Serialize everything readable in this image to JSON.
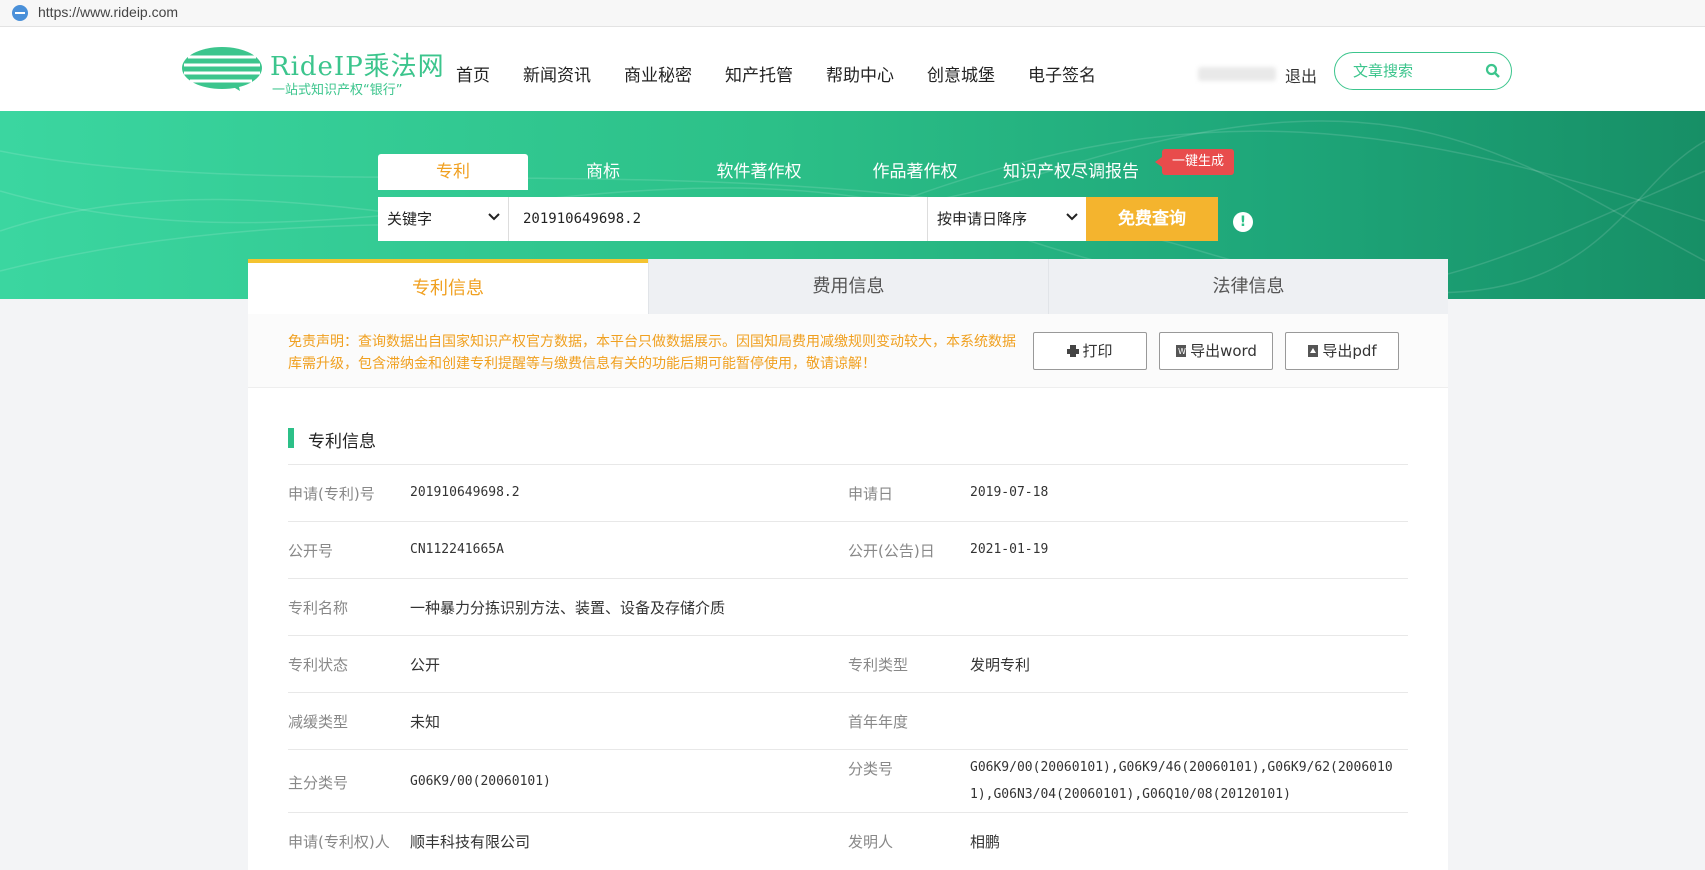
{
  "browser": {
    "url": "https://www.rideip.com"
  },
  "header": {
    "logo_title": "RideIP乘法网",
    "logo_sub": "一站式知识产权“银行”",
    "nav": [
      "首页",
      "新闻资讯",
      "商业秘密",
      "知产托管",
      "帮助中心",
      "创意城堡",
      "电子签名"
    ],
    "logout": "退出",
    "search_placeholder": "文章搜索"
  },
  "search": {
    "types": [
      "专利",
      "商标",
      "软件著作权",
      "作品著作权",
      "知识产权尽调报告"
    ],
    "active_type": "专利",
    "badge": "一键生成",
    "field_select": "关键字",
    "query": "201910649698.2",
    "sort_select": "按申请日降序",
    "submit": "免费查询",
    "info_icon": "!"
  },
  "detail_tabs": [
    "专利信息",
    "费用信息",
    "法律信息"
  ],
  "notice": "免责声明：查询数据出自国家知识产权官方数据，本平台只做数据展示。因国知局费用减缴规则变动较大，本系统数据库需升级，包含滞纳金和创建专利提醒等与缴费信息有关的功能后期可能暂停使用，敬请谅解！",
  "actions": {
    "print": "打印",
    "export_word": "导出word",
    "export_pdf": "导出pdf"
  },
  "section_title": "专利信息",
  "fields": {
    "app_no_label": "申请(专利)号",
    "app_no": "201910649698.2",
    "app_date_label": "申请日",
    "app_date": "2019-07-18",
    "pub_no_label": "公开号",
    "pub_no": "CN112241665A",
    "pub_date_label": "公开(公告)日",
    "pub_date": "2021-01-19",
    "name_label": "专利名称",
    "name": "一种暴力分拣识别方法、装置、设备及存储介质",
    "status_label": "专利状态",
    "status": "公开",
    "type_label": "专利类型",
    "type": "发明专利",
    "reduction_label": "减缓类型",
    "reduction": "未知",
    "first_year_label": "首年年度",
    "first_year": "",
    "main_class_label": "主分类号",
    "main_class": "G06K9/00(20060101)",
    "class_label": "分类号",
    "class": "G06K9/00(20060101),G06K9/46(20060101),G06K9/62(20060101),G06N3/04(20060101),G06Q10/08(20120101)",
    "applicant_label": "申请(专利权)人",
    "applicant": "顺丰科技有限公司",
    "inventor_label": "发明人",
    "inventor": "相鹏"
  },
  "colors": {
    "brand_green": "#2cc088",
    "accent_orange": "#f0a020",
    "search_button": "#f4b42e",
    "badge_red": "#e84c4c"
  }
}
